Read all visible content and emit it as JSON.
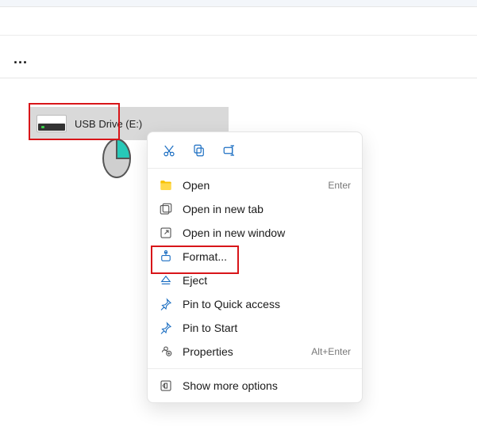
{
  "overflow_label": "...",
  "drive": {
    "label": "USB Drive (E:)"
  },
  "iconbar": {
    "cut": "cut-icon",
    "copy": "copy-icon",
    "rename": "rename-icon"
  },
  "menu": {
    "open": {
      "label": "Open",
      "shortcut": "Enter"
    },
    "open_tab": {
      "label": "Open in new tab"
    },
    "open_window": {
      "label": "Open in new window"
    },
    "format": {
      "label": "Format..."
    },
    "eject": {
      "label": "Eject"
    },
    "pin_quick": {
      "label": "Pin to Quick access"
    },
    "pin_start": {
      "label": "Pin to Start"
    },
    "properties": {
      "label": "Properties",
      "shortcut": "Alt+Enter"
    },
    "more": {
      "label": "Show more options"
    }
  }
}
